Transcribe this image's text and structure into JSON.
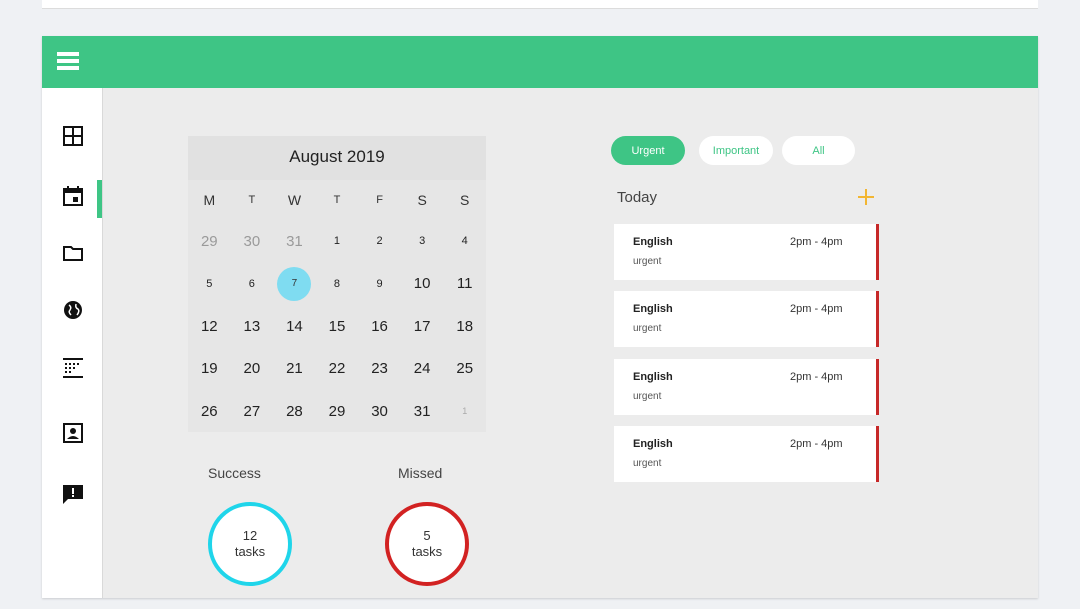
{
  "calendar": {
    "month_label": "August 2019",
    "weekdays": [
      "M",
      "T",
      "W",
      "T",
      "F",
      "S",
      "S"
    ],
    "weeks": [
      [
        "29",
        "30",
        "31",
        "1",
        "2",
        "3",
        "4"
      ],
      [
        "5",
        "6",
        "7",
        "8",
        "9",
        "10",
        "11"
      ],
      [
        "12",
        "13",
        "14",
        "15",
        "16",
        "17",
        "18"
      ],
      [
        "19",
        "20",
        "21",
        "22",
        "23",
        "24",
        "25"
      ],
      [
        "26",
        "27",
        "28",
        "29",
        "30",
        "31",
        "1"
      ]
    ],
    "selected_day": "7"
  },
  "stats": {
    "success_label": "Success",
    "success_count": "12",
    "success_unit": "tasks",
    "missed_label": "Missed",
    "missed_count": "5",
    "missed_unit": "tasks"
  },
  "filters": {
    "urgent": "Urgent",
    "important": "Important",
    "all": "All",
    "active": "Urgent"
  },
  "tasks_panel": {
    "today_label": "Today",
    "tasks": [
      {
        "title": "English",
        "time": "2pm - 4pm",
        "tag": "urgent"
      },
      {
        "title": "English",
        "time": "2pm - 4pm",
        "tag": "urgent"
      },
      {
        "title": "English",
        "time": "2pm - 4pm",
        "tag": "urgent"
      },
      {
        "title": "English",
        "time": "2pm - 4pm",
        "tag": "urgent"
      }
    ]
  },
  "sidebar": {
    "icons": [
      "grid-icon",
      "calendar-icon",
      "folder-icon",
      "globe-icon",
      "timetable-icon",
      "contact-icon",
      "feedback-icon"
    ],
    "active": "calendar-icon"
  },
  "colors": {
    "accent": "#3ec585",
    "success_ring": "#1fd5ea",
    "missed_ring": "#d22222",
    "selected_day": "#7fdcf1",
    "add_icon": "#f2b632",
    "task_border": "#c62828"
  }
}
